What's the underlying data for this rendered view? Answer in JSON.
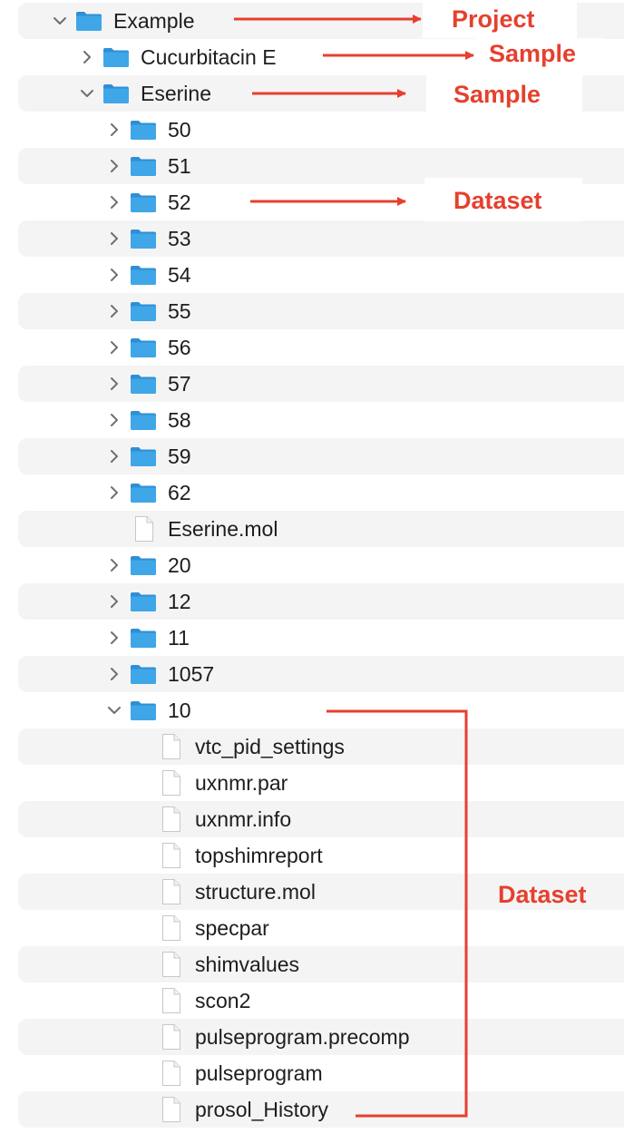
{
  "tree": [
    {
      "label": "Example",
      "type": "folder",
      "depth": 0,
      "state": "expanded"
    },
    {
      "label": "Cucurbitacin E",
      "type": "folder",
      "depth": 1,
      "state": "collapsed"
    },
    {
      "label": "Eserine",
      "type": "folder",
      "depth": 1,
      "state": "expanded"
    },
    {
      "label": "50",
      "type": "folder",
      "depth": 2,
      "state": "collapsed"
    },
    {
      "label": "51",
      "type": "folder",
      "depth": 2,
      "state": "collapsed"
    },
    {
      "label": "52",
      "type": "folder",
      "depth": 2,
      "state": "collapsed"
    },
    {
      "label": "53",
      "type": "folder",
      "depth": 2,
      "state": "collapsed"
    },
    {
      "label": "54",
      "type": "folder",
      "depth": 2,
      "state": "collapsed"
    },
    {
      "label": "55",
      "type": "folder",
      "depth": 2,
      "state": "collapsed"
    },
    {
      "label": "56",
      "type": "folder",
      "depth": 2,
      "state": "collapsed"
    },
    {
      "label": "57",
      "type": "folder",
      "depth": 2,
      "state": "collapsed"
    },
    {
      "label": "58",
      "type": "folder",
      "depth": 2,
      "state": "collapsed"
    },
    {
      "label": "59",
      "type": "folder",
      "depth": 2,
      "state": "collapsed"
    },
    {
      "label": "62",
      "type": "folder",
      "depth": 2,
      "state": "collapsed"
    },
    {
      "label": "Eserine.mol",
      "type": "file",
      "depth": 2,
      "state": "none"
    },
    {
      "label": "20",
      "type": "folder",
      "depth": 2,
      "state": "collapsed"
    },
    {
      "label": "12",
      "type": "folder",
      "depth": 2,
      "state": "collapsed"
    },
    {
      "label": "11",
      "type": "folder",
      "depth": 2,
      "state": "collapsed"
    },
    {
      "label": "1057",
      "type": "folder",
      "depth": 2,
      "state": "collapsed"
    },
    {
      "label": "10",
      "type": "folder",
      "depth": 2,
      "state": "expanded"
    },
    {
      "label": "vtc_pid_settings",
      "type": "file",
      "depth": 3,
      "state": "none"
    },
    {
      "label": "uxnmr.par",
      "type": "file",
      "depth": 3,
      "state": "none"
    },
    {
      "label": "uxnmr.info",
      "type": "file",
      "depth": 3,
      "state": "none"
    },
    {
      "label": "topshimreport",
      "type": "file",
      "depth": 3,
      "state": "none"
    },
    {
      "label": "structure.mol",
      "type": "file",
      "depth": 3,
      "state": "none"
    },
    {
      "label": "specpar",
      "type": "file",
      "depth": 3,
      "state": "none"
    },
    {
      "label": "shimvalues",
      "type": "file",
      "depth": 3,
      "state": "none"
    },
    {
      "label": "scon2",
      "type": "file",
      "depth": 3,
      "state": "none"
    },
    {
      "label": "pulseprogram.precomp",
      "type": "file",
      "depth": 3,
      "state": "none"
    },
    {
      "label": "pulseprogram",
      "type": "file",
      "depth": 3,
      "state": "none"
    },
    {
      "label": "prosol_History",
      "type": "file",
      "depth": 3,
      "state": "none"
    }
  ],
  "annotations": {
    "project": "Project",
    "sample_1": "Sample",
    "sample_2": "Sample",
    "dataset_1": "Dataset",
    "dataset_2": "Dataset"
  },
  "colors": {
    "annotation": "#e6402e",
    "folder_front": "#3fa6e8",
    "folder_back": "#2f8fd6",
    "stripe": "#f4f4f5",
    "text": "#1d1d1f"
  }
}
